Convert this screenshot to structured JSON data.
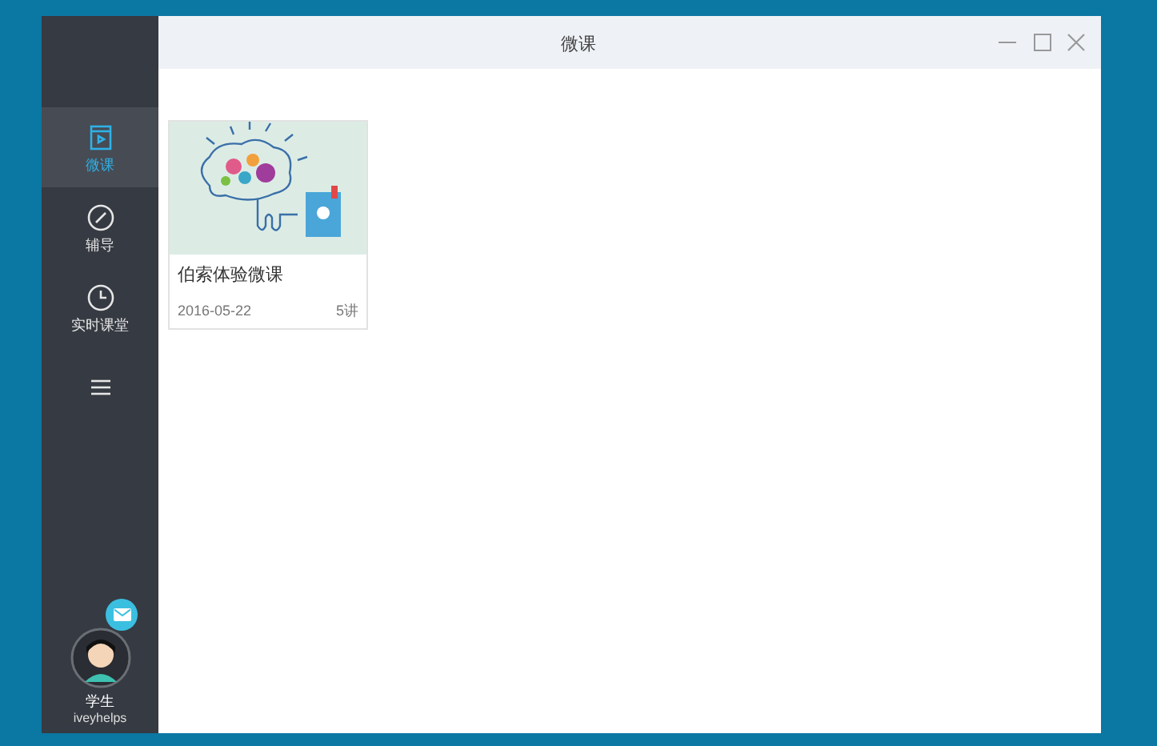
{
  "window": {
    "title": "微课"
  },
  "sidebar": {
    "items": [
      {
        "kind": "video",
        "label": "微课",
        "selected": true
      },
      {
        "kind": "compass",
        "label": "辅导",
        "selected": false
      },
      {
        "kind": "clock",
        "label": "实时课堂",
        "selected": false
      },
      {
        "kind": "list",
        "selected": false
      }
    ],
    "user": {
      "role": "学生",
      "name": "iveyhelps"
    }
  },
  "courses": [
    {
      "title": "伯索体验微课",
      "date": "2016-05-22",
      "lessons": "5讲"
    }
  ]
}
